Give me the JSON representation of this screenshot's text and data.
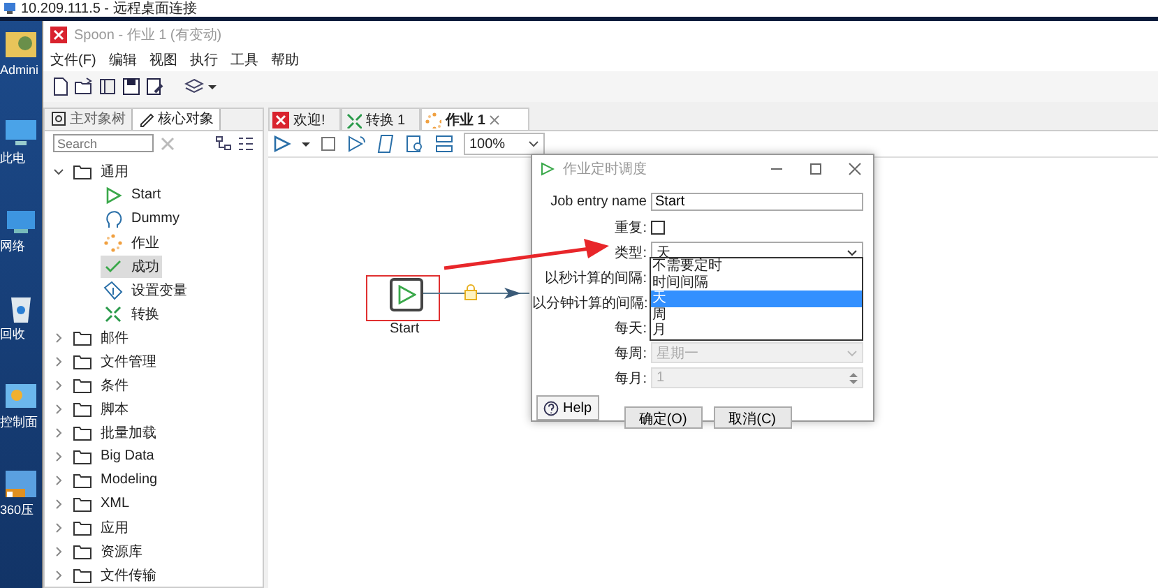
{
  "remote_desktop": {
    "title": "10.209.111.5 - 远程桌面连接"
  },
  "desktop_icons": [
    {
      "label": "Admini",
      "kind": "user"
    },
    {
      "label": "此电",
      "kind": "computer"
    },
    {
      "label": "网络",
      "kind": "network"
    },
    {
      "label": "回收",
      "kind": "recycle"
    },
    {
      "label": "控制面",
      "kind": "control"
    },
    {
      "label": "360压",
      "kind": "archive"
    }
  ],
  "window": {
    "title": "Spoon - 作业 1 (有变动)"
  },
  "menu": [
    "文件(F)",
    "编辑",
    "视图",
    "执行",
    "工具",
    "帮助"
  ],
  "left_panel": {
    "tabs": [
      {
        "label": "主对象树",
        "kind": "tree",
        "selected": false
      },
      {
        "label": "核心对象",
        "kind": "pencil",
        "selected": true
      }
    ],
    "search": {
      "placeholder": "Search"
    },
    "tree": [
      {
        "label": "通用",
        "expanded": true,
        "children": [
          {
            "label": "Start",
            "kind": "start",
            "selected": false
          },
          {
            "label": "Dummy",
            "kind": "dummy",
            "selected": false
          },
          {
            "label": "作业",
            "kind": "job",
            "selected": false
          },
          {
            "label": "成功",
            "kind": "success",
            "selected": true
          },
          {
            "label": "设置变量",
            "kind": "variable",
            "selected": false
          },
          {
            "label": "转换",
            "kind": "transform",
            "selected": false
          }
        ]
      },
      {
        "label": "邮件",
        "expanded": false
      },
      {
        "label": "文件管理",
        "expanded": false
      },
      {
        "label": "条件",
        "expanded": false
      },
      {
        "label": "脚本",
        "expanded": false
      },
      {
        "label": "批量加载",
        "expanded": false
      },
      {
        "label": "Big Data",
        "expanded": false
      },
      {
        "label": "Modeling",
        "expanded": false
      },
      {
        "label": "XML",
        "expanded": false
      },
      {
        "label": "应用",
        "expanded": false
      },
      {
        "label": "资源库",
        "expanded": false
      },
      {
        "label": "文件传输",
        "expanded": false
      }
    ]
  },
  "editor_tabs": [
    {
      "label": "欢迎!",
      "kind": "welcome",
      "selected": false,
      "closable": false
    },
    {
      "label": "转换 1",
      "kind": "transform",
      "selected": false,
      "closable": false
    },
    {
      "label": "作业 1",
      "kind": "job",
      "selected": true,
      "closable": true
    }
  ],
  "zoom": {
    "value": "100%"
  },
  "canvas": {
    "node": {
      "label": "Start",
      "highlighted": true
    }
  },
  "dialog": {
    "title": "作业定时调度",
    "fields": [
      {
        "kind": "text",
        "label": "Job entry name",
        "value": "Start",
        "disabled": false
      },
      {
        "kind": "checkbox",
        "label": "重复:",
        "checked": false,
        "disabled": false
      },
      {
        "kind": "select",
        "label": "类型:",
        "value": "天",
        "disabled": false
      },
      {
        "kind": "covered",
        "label": "以秒计算的间隔:"
      },
      {
        "kind": "covered",
        "label": "以分钟计算的间隔:"
      },
      {
        "kind": "covered",
        "label": "每天:"
      },
      {
        "kind": "select",
        "label": "每周:",
        "value": "星期一",
        "disabled": true
      },
      {
        "kind": "spinner",
        "label": "每月:",
        "value": "1",
        "disabled": true
      }
    ],
    "help": "Help",
    "buttons": [
      "确定(O)",
      "取消(C)"
    ]
  },
  "dropdown": {
    "options": [
      {
        "label": "不需要定时",
        "selected": false
      },
      {
        "label": "时间间隔",
        "selected": false
      },
      {
        "label": "天",
        "selected": true
      },
      {
        "label": "周",
        "selected": false
      },
      {
        "label": "月",
        "selected": false
      }
    ]
  }
}
